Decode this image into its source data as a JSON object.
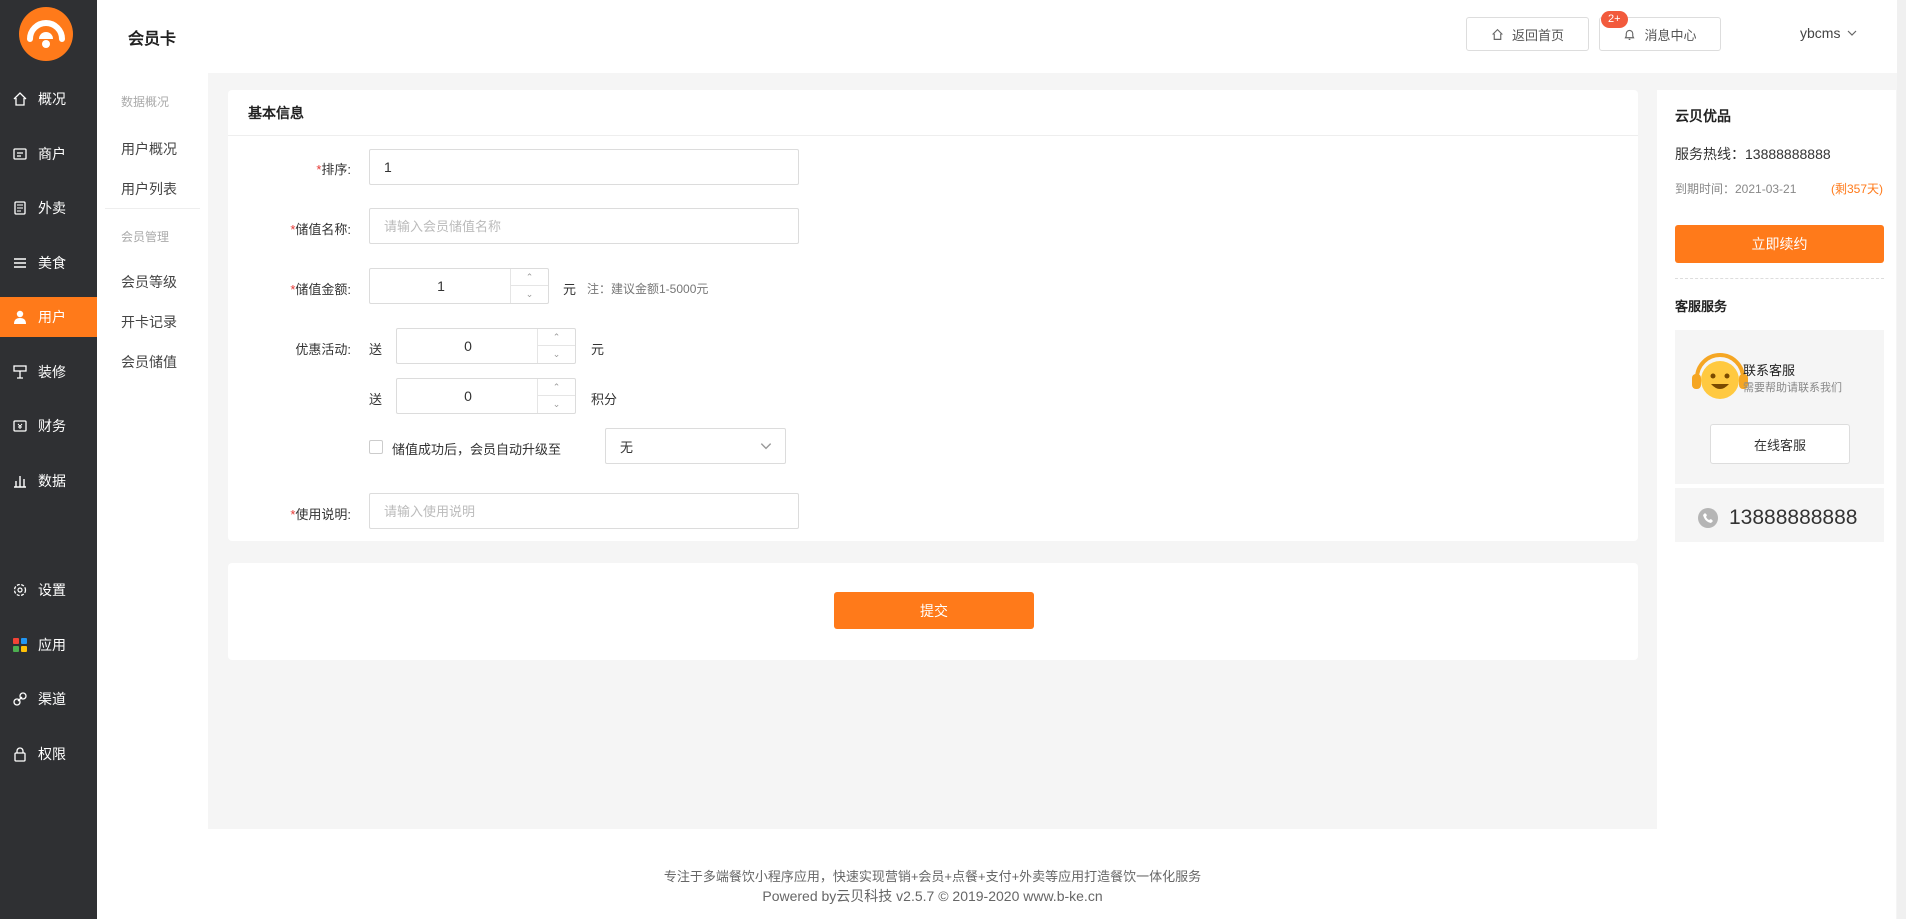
{
  "app": {
    "page_title": "会员卡"
  },
  "sidebar": {
    "items": [
      {
        "label": "概况",
        "icon": "home-icon"
      },
      {
        "label": "商户",
        "icon": "store-icon"
      },
      {
        "label": "外卖",
        "icon": "takeout-icon"
      },
      {
        "label": "美食",
        "icon": "menu-icon"
      },
      {
        "label": "用户",
        "icon": "user-icon",
        "active": true
      },
      {
        "label": "装修",
        "icon": "decorate-icon"
      },
      {
        "label": "财务",
        "icon": "finance-icon"
      },
      {
        "label": "数据",
        "icon": "chart-icon"
      },
      {
        "label": "设置",
        "icon": "gear-icon"
      },
      {
        "label": "应用",
        "icon": "apps-icon"
      },
      {
        "label": "渠道",
        "icon": "link-icon"
      },
      {
        "label": "权限",
        "icon": "lock-icon"
      }
    ]
  },
  "subnav": {
    "group1": "数据概况",
    "group1_items": [
      "用户概况",
      "用户列表"
    ],
    "group2": "会员管理",
    "group2_items": [
      "会员等级",
      "开卡记录",
      "会员储值"
    ]
  },
  "header": {
    "home_button": "返回首页",
    "messages_button": "消息中心",
    "messages_badge": "2+",
    "username": "ybcms"
  },
  "form": {
    "section_title": "基本信息",
    "sort_label": "排序:",
    "sort_value": "1",
    "name_label": "储值名称:",
    "name_placeholder": "请输入会员储值名称",
    "amount_label": "储值金额:",
    "amount_value": "1",
    "amount_unit": "元",
    "amount_note": "注：建议金额1-5000元",
    "promo_label": "优惠活动:",
    "promo_give": "送",
    "promo_money_value": "0",
    "promo_money_unit": "元",
    "promo_points_value": "0",
    "promo_points_unit": "积分",
    "upgrade_label": "储值成功后，会员自动升级至",
    "upgrade_select": "无",
    "usage_label": "使用说明:",
    "usage_placeholder": "请输入使用说明",
    "submit": "提交"
  },
  "right_panel": {
    "title": "云贝优品",
    "hotline": "服务热线：13888888888",
    "expire": "到期时间：2021-03-21",
    "remaining": "(剩357天)",
    "renew_button": "立即续约",
    "service_title": "客服服务",
    "contact_name": "联系客服",
    "contact_sub": "需要帮助请联系我们",
    "online_button": "在线客服",
    "phone": "13888888888"
  },
  "footer": {
    "line1": "专注于多端餐饮小程序应用，快速实现营销+会员+点餐+支付+外卖等应用打造餐饮一体化服务",
    "line2": "Powered by云贝科技 v2.5.7 © 2019-2020 www.b-ke.cn"
  },
  "colors": {
    "accent": "#ff7a1a",
    "sidebar_bg": "#2f3033",
    "badge": "#f25a3c"
  }
}
